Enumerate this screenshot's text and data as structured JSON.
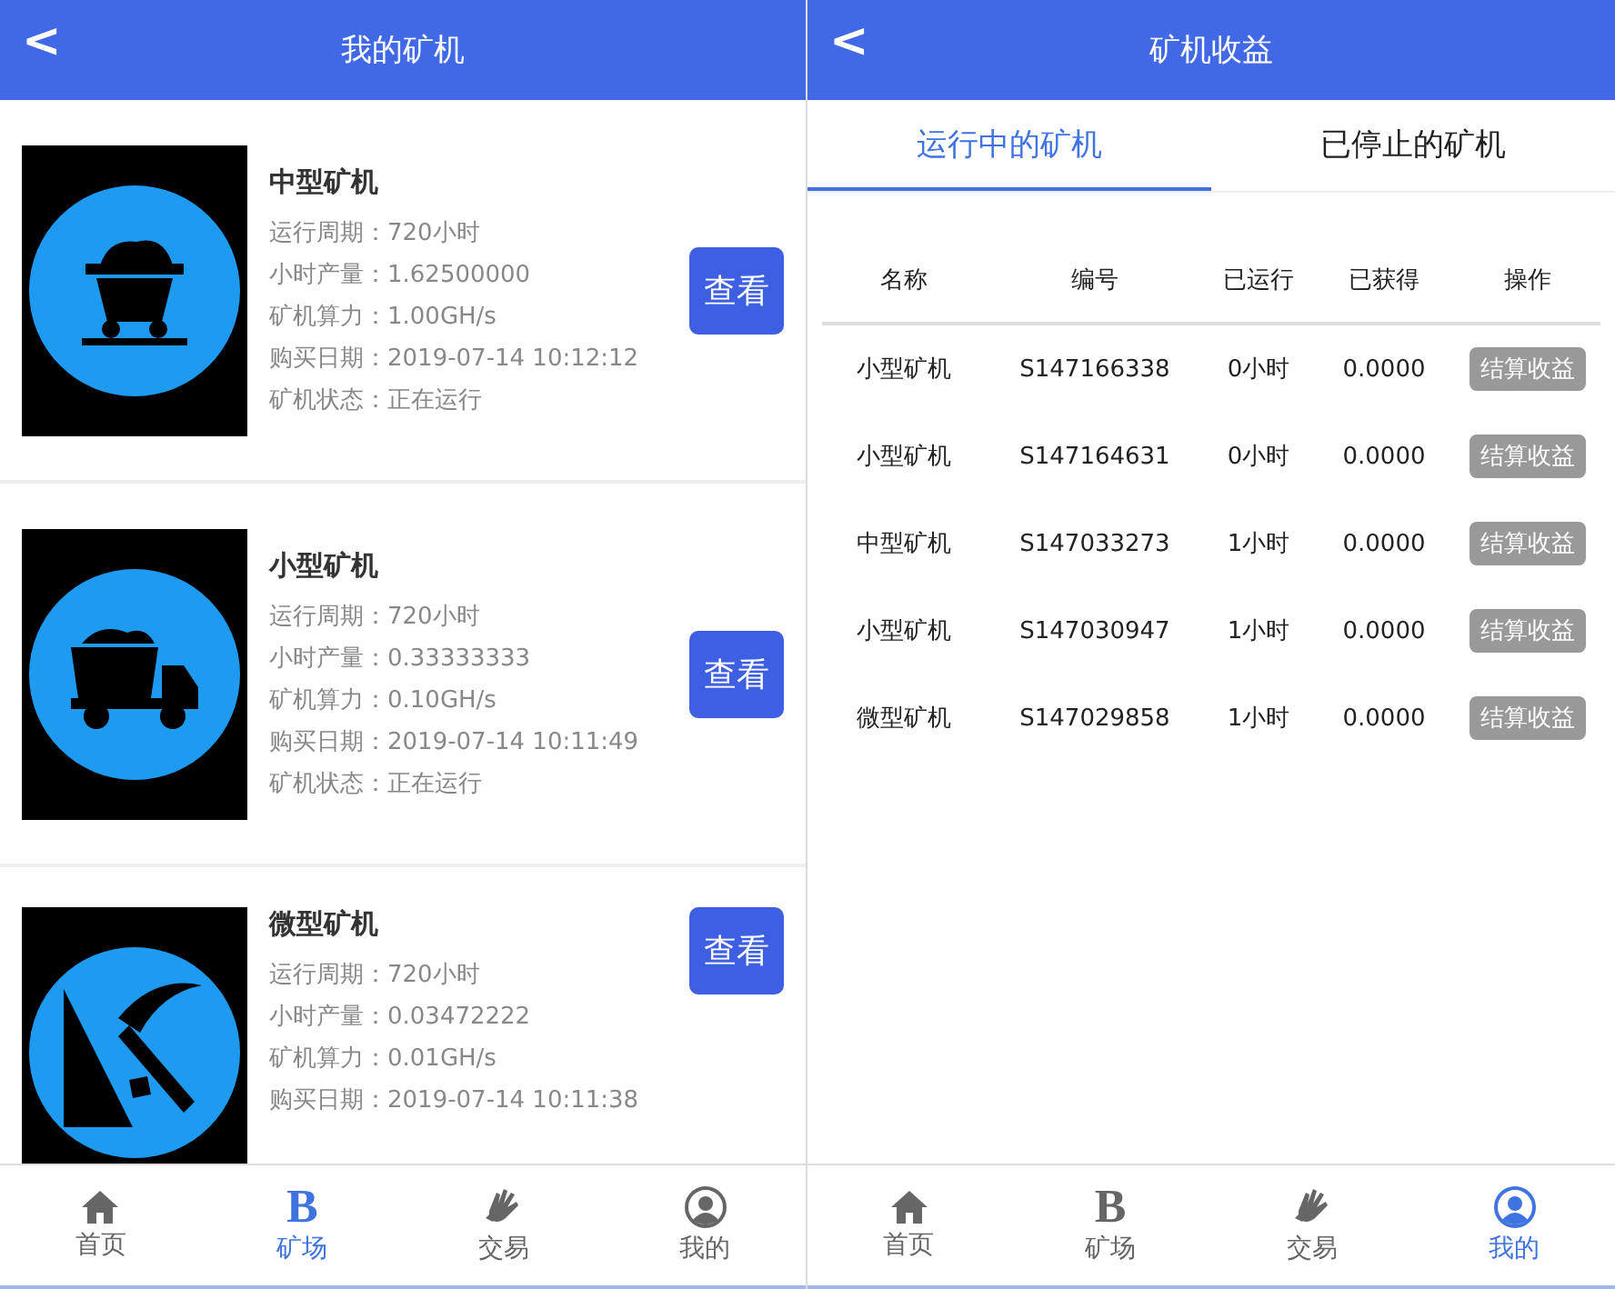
{
  "left_screen": {
    "header": {
      "back": "<",
      "title": "我的矿机"
    },
    "machines": [
      {
        "kind": "cart",
        "name": "中型矿机",
        "details": [
          {
            "label": "运行周期：",
            "value": "720小时"
          },
          {
            "label": "小时产量：",
            "value": "1.62500000"
          },
          {
            "label": "矿机算力：",
            "value": "1.00GH/s"
          },
          {
            "label": "购买日期：",
            "value": "2019-07-14 10:12:12"
          },
          {
            "label": "矿机状态：",
            "value": "正在运行"
          }
        ],
        "button": "查看"
      },
      {
        "kind": "truck",
        "name": "小型矿机",
        "details": [
          {
            "label": "运行周期：",
            "value": "720小时"
          },
          {
            "label": "小时产量：",
            "value": "0.33333333"
          },
          {
            "label": "矿机算力：",
            "value": "0.10GH/s"
          },
          {
            "label": "购买日期：",
            "value": "2019-07-14 10:11:49"
          },
          {
            "label": "矿机状态：",
            "value": "正在运行"
          }
        ],
        "button": "查看"
      },
      {
        "kind": "pickaxe",
        "name": "微型矿机",
        "details": [
          {
            "label": "运行周期：",
            "value": "720小时"
          },
          {
            "label": "小时产量：",
            "value": "0.03472222"
          },
          {
            "label": "矿机算力：",
            "value": "0.01GH/s"
          },
          {
            "label": "购买日期：",
            "value": "2019-07-14 10:11:38"
          }
        ],
        "button": "查看"
      }
    ],
    "tab_bar": [
      {
        "kind": "home",
        "label": "首页",
        "selected": false
      },
      {
        "kind": "letter",
        "icon_char": "B",
        "label": "矿场",
        "selected": true
      },
      {
        "kind": "hands",
        "label": "交易",
        "selected": false
      },
      {
        "kind": "user",
        "label": "我的",
        "selected": false
      }
    ]
  },
  "right_screen": {
    "header": {
      "back": "<",
      "title": "矿机收益"
    },
    "tabs": [
      {
        "label": "运行中的矿机",
        "selected": true
      },
      {
        "label": "已停止的矿机",
        "selected": false
      }
    ],
    "table": {
      "columns": [
        "名称",
        "编号",
        "已运行",
        "已获得",
        "操作"
      ],
      "rows": [
        {
          "cells": [
            "小型矿机",
            "S147166338",
            "0小时",
            "0.0000"
          ],
          "action": "结算收益",
          "disabled": true
        },
        {
          "cells": [
            "小型矿机",
            "S147164631",
            "0小时",
            "0.0000"
          ],
          "action": "结算收益",
          "disabled": true
        },
        {
          "cells": [
            "中型矿机",
            "S147033273",
            "1小时",
            "0.0000"
          ],
          "action": "结算收益",
          "disabled": true
        },
        {
          "cells": [
            "小型矿机",
            "S147030947",
            "1小时",
            "0.0000"
          ],
          "action": "结算收益",
          "disabled": true
        },
        {
          "cells": [
            "微型矿机",
            "S147029858",
            "1小时",
            "0.0000"
          ],
          "action": "结算收益",
          "disabled": true
        }
      ]
    },
    "tab_bar": [
      {
        "kind": "home",
        "label": "首页",
        "selected": false
      },
      {
        "kind": "letter",
        "icon_char": "B",
        "label": "矿场",
        "selected": false
      },
      {
        "kind": "hands",
        "label": "交易",
        "selected": false
      },
      {
        "kind": "user",
        "label": "我的",
        "selected": true
      }
    ]
  }
}
